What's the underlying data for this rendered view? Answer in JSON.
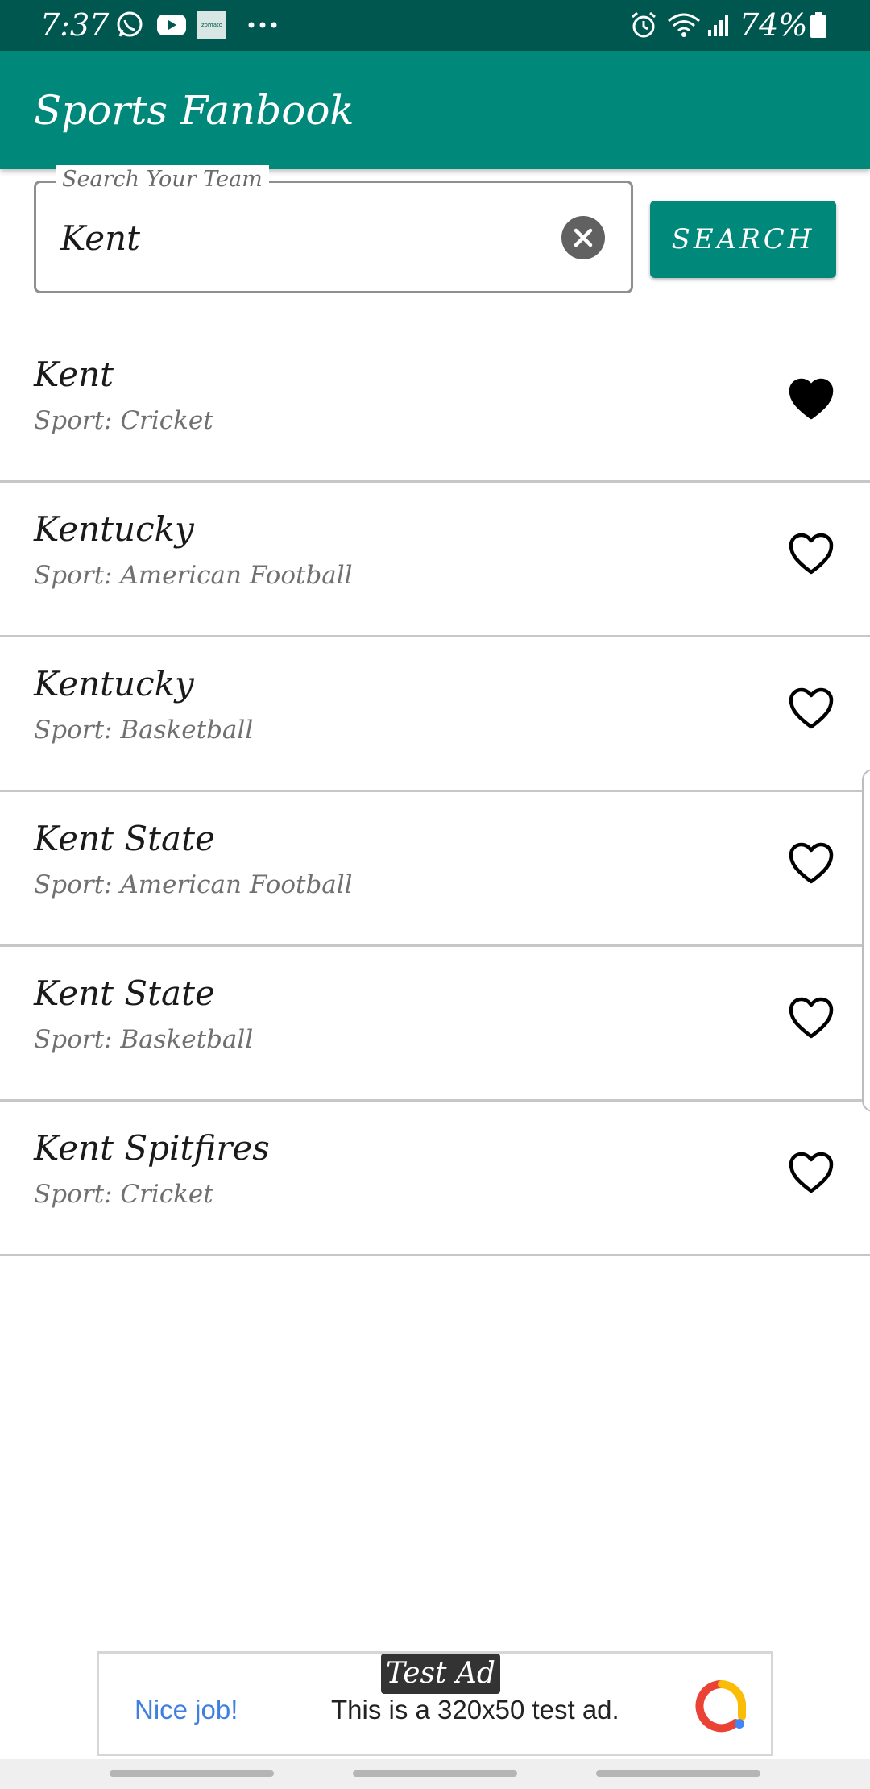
{
  "status_bar": {
    "time": "7:37",
    "battery": "74%",
    "icons": [
      "whatsapp-icon",
      "youtube-icon",
      "zomato-icon",
      "more-notifications-icon",
      "alarm-icon",
      "wifi-icon",
      "signal-icon",
      "battery-icon"
    ],
    "zomato_label": "zomato"
  },
  "app_bar": {
    "title": "Sports Fanbook",
    "color": "#00897b"
  },
  "search": {
    "label": "Search Your Team",
    "value": "Kent",
    "button_label": "SEARCH"
  },
  "teams": [
    {
      "name": "Kent",
      "sport": "Sport: Cricket",
      "favorite": true
    },
    {
      "name": "Kentucky",
      "sport": "Sport: American Football",
      "favorite": false
    },
    {
      "name": "Kentucky",
      "sport": "Sport: Basketball",
      "favorite": false
    },
    {
      "name": "Kent State",
      "sport": "Sport: American Football",
      "favorite": false
    },
    {
      "name": "Kent State",
      "sport": "Sport: Basketball",
      "favorite": false
    },
    {
      "name": "Kent Spitfires",
      "sport": "Sport: Cricket",
      "favorite": false
    }
  ],
  "ad": {
    "badge": "Test Ad",
    "headline": "Nice job!",
    "text": "This is a 320x50 test ad."
  }
}
